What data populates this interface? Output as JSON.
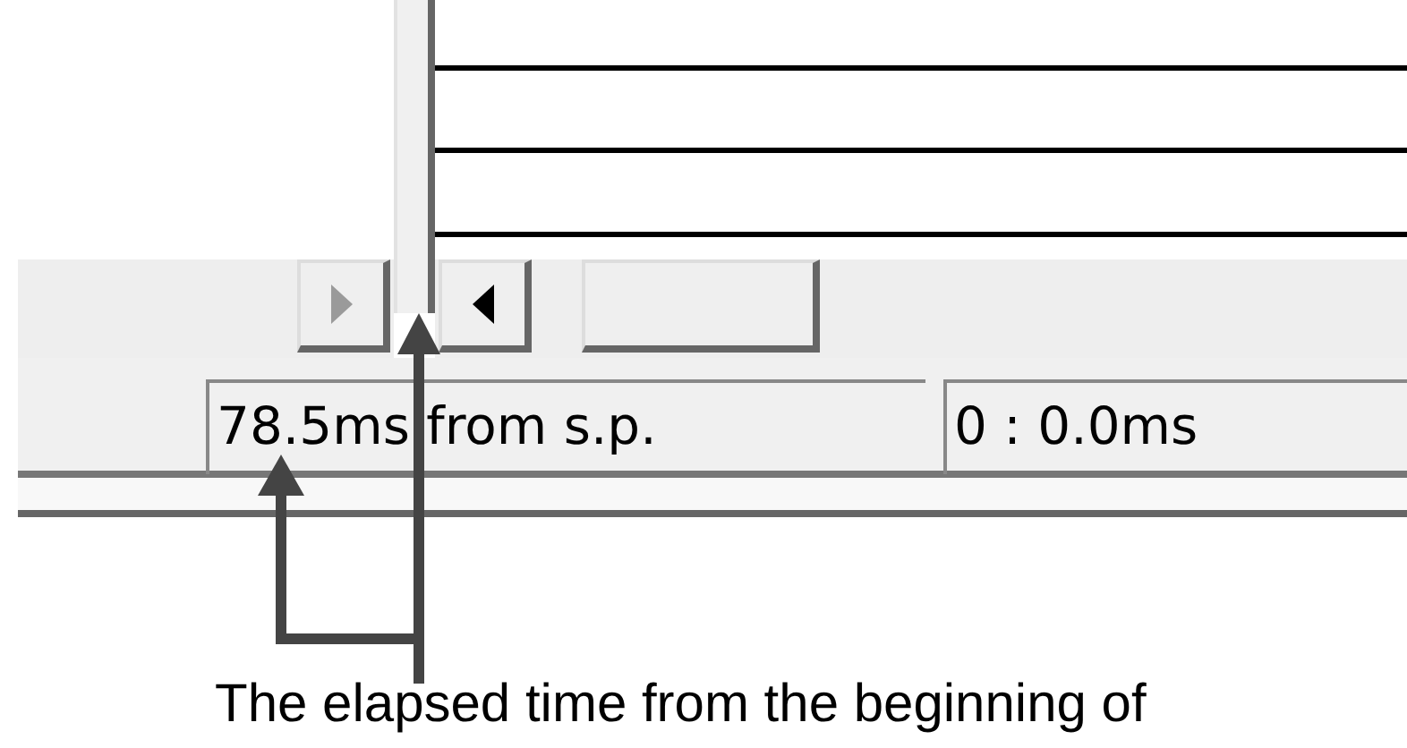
{
  "toolbar_buttons": [
    {
      "kind": "play",
      "disabled": true
    },
    {
      "kind": "back",
      "disabled": false
    },
    {
      "kind": "blank",
      "disabled": false
    }
  ],
  "status_bar": {
    "fields": [
      "78.5ms from s.p.",
      "0 : 0.0ms"
    ]
  },
  "caption": "The elapsed time from the beginning of"
}
